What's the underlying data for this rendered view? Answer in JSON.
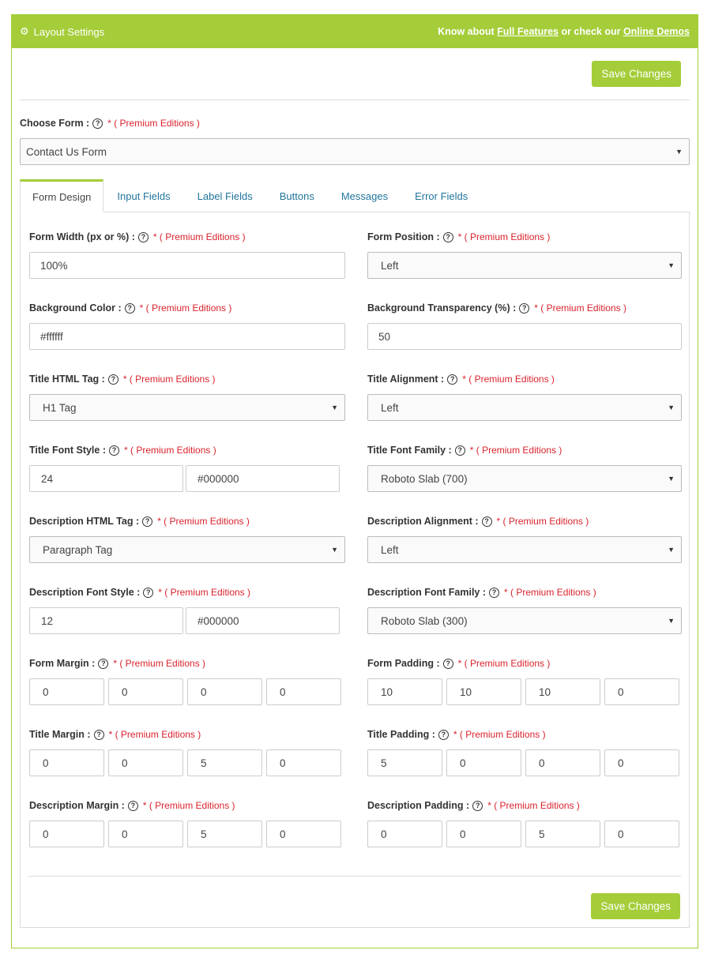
{
  "header": {
    "title": "Layout Settings",
    "know_about": "Know about ",
    "full_features": "Full Features",
    "or_check": " or check our ",
    "online_demos": "Online Demos"
  },
  "save_label": "Save Changes",
  "choose_form": {
    "label": "Choose Form :",
    "premium": "* ( Premium Editions )",
    "value": "Contact Us Form"
  },
  "tabs": [
    "Form Design",
    "Input Fields",
    "Label Fields",
    "Buttons",
    "Messages",
    "Error Fields"
  ],
  "fields": {
    "form_width": {
      "label": "Form Width (px or %) :",
      "value": "100%"
    },
    "form_position": {
      "label": "Form Position :",
      "value": "Left"
    },
    "background_color": {
      "label": "Background Color :",
      "value": "#ffffff"
    },
    "background_transparency": {
      "label": "Background Transparency (%) :",
      "value": "50"
    },
    "title_html_tag": {
      "label": "Title HTML Tag :",
      "value": "H1 Tag"
    },
    "title_alignment": {
      "label": "Title Alignment :",
      "value": "Left"
    },
    "title_font_style": {
      "label": "Title Font Style :",
      "size": "24",
      "color": "#000000"
    },
    "title_font_family": {
      "label": "Title Font Family :",
      "value": "Roboto Slab (700)"
    },
    "description_html_tag": {
      "label": "Description HTML Tag :",
      "value": "Paragraph Tag"
    },
    "description_alignment": {
      "label": "Description Alignment :",
      "value": "Left"
    },
    "description_font_style": {
      "label": "Description Font Style :",
      "size": "12",
      "color": "#000000"
    },
    "description_font_family": {
      "label": "Description Font Family :",
      "value": "Roboto Slab (300)"
    },
    "form_margin": {
      "label": "Form Margin :",
      "values": [
        "0",
        "0",
        "0",
        "0"
      ]
    },
    "form_padding": {
      "label": "Form Padding :",
      "values": [
        "10",
        "10",
        "10",
        "0"
      ]
    },
    "title_margin": {
      "label": "Title Margin :",
      "values": [
        "0",
        "0",
        "5",
        "0"
      ]
    },
    "title_padding": {
      "label": "Title Padding :",
      "values": [
        "5",
        "0",
        "0",
        "0"
      ]
    },
    "description_margin": {
      "label": "Description Margin :",
      "values": [
        "0",
        "0",
        "5",
        "0"
      ]
    },
    "description_padding": {
      "label": "Description Padding :",
      "values": [
        "0",
        "0",
        "5",
        "0"
      ]
    }
  },
  "premium_note": "* ( Premium Editions )",
  "colors": {
    "accent": "#a4cd39",
    "premium": "#d9232d",
    "tab_link": "#21759b"
  },
  "icons": {
    "header": "gear-icon",
    "help": "question-circle-icon",
    "select": "caret-down-icon"
  }
}
